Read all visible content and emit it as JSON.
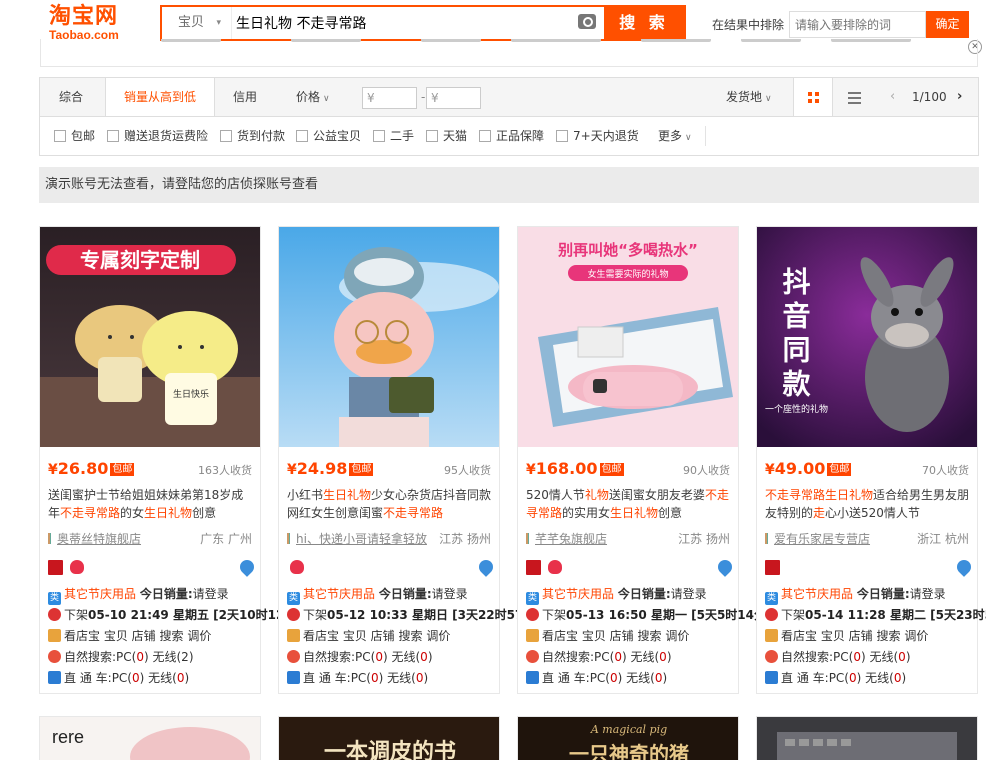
{
  "header": {
    "logo_cn": "淘宝网",
    "logo_en": "Taobao.com",
    "search_category": "宝贝",
    "search_value": "生日礼物 不走寻常路",
    "search_button": "搜 索",
    "exclude_label": "在结果中排除",
    "exclude_placeholder": "请输入要排除的词",
    "exclude_button": "确定",
    "close": "✕"
  },
  "sortbar": {
    "items": [
      "综合",
      "销量从高到低",
      "信用",
      "价格"
    ],
    "price_min": "¥",
    "price_max": "¥",
    "ship_from": "发货地",
    "page": "1/100",
    "prev": "‹",
    "next": "›"
  },
  "filters": [
    "包邮",
    "赠送退货运费险",
    "货到付款",
    "公益宝贝",
    "二手",
    "天猫",
    "正品保障",
    "7+天内退货"
  ],
  "filters_more": "更多",
  "notice": "演示账号无法查看，请登陆您的店侦探账号查看",
  "common": {
    "price_tag": "包邮",
    "yen": "¥",
    "cat_prefix": "其它节庆用品",
    "sales_label": "今日销量:",
    "sales_value": "请登录",
    "shelf_prefix": "下架",
    "tools": [
      "看店宝 宝贝",
      "店铺",
      "搜索",
      "调价"
    ],
    "natural_search": "自然搜索:",
    "pc": "PC(",
    "zero": "0",
    "close_paren": ")",
    "wireless": " 无线(",
    "through_train": "直 通 车:",
    "icon_colors": {
      "cat": "#2d8be0",
      "clock": "#d33",
      "tool": "#e8a33c",
      "search": "#e8503c",
      "car": "#2b7cd3"
    }
  },
  "cards": [
    {
      "price": "26.80",
      "sold": "163人收货",
      "title_parts": [
        "送闺蜜护士节给姐姐妹妹弟第18岁成年",
        "不走寻常路",
        "的女",
        "生日礼物",
        "创意"
      ],
      "shop": "奥蒂丝特旗舰店",
      "location": "广东 广州",
      "shelf_time": "05-10 21:49 星期五 [2天10时12分]",
      "wireless_count": "2",
      "wireless_red": false
    },
    {
      "price": "24.98",
      "sold": "95人收货",
      "title_parts": [
        "小红书",
        "生日礼物",
        "少女心杂货店抖音同款网红女生创意闺蜜",
        "不走寻常路",
        ""
      ],
      "shop": "hi、快递小哥请轻拿轻放",
      "location": "江苏 扬州",
      "shelf_time": "05-12 10:33 星期日 [3天22时57分]",
      "wireless_count": "0",
      "wireless_red": true
    },
    {
      "price": "168.00",
      "sold": "90人收货",
      "title_parts": [
        "520情人节",
        "礼物",
        "送闺蜜女朋友老婆",
        "不走寻常路",
        "的实用女",
        "生日礼物",
        "创意"
      ],
      "shop": "芊芊兔旗舰店",
      "location": "江苏 扬州",
      "shelf_time": "05-13 16:50 星期一 [5天5时14分]",
      "wireless_count": "0",
      "wireless_red": true
    },
    {
      "price": "49.00",
      "sold": "70人收货",
      "title_parts": [
        "",
        "不走寻常路生日礼物",
        "适合给男生男友朋友特别的",
        "走",
        "心小送520情人节"
      ],
      "shop": "爱有乐家居专营店",
      "location": "浙江 杭州",
      "shelf_time": "05-14 11:28 星期二 [5天23时52分]",
      "wireless_count": "0",
      "wireless_red": true
    }
  ],
  "images": {
    "img1_banner": "专属刻字定制",
    "img1_lamp": "生日快乐",
    "img3_banner": "别再叫她“多喝热水”",
    "img3_sub": "女生需要实际的礼物",
    "img4_big": "抖音同款",
    "img4_small": "一个座性的礼物",
    "row2_1": "rere",
    "row2_2": "一本调皮的书",
    "row2_3_script": "A magical pig",
    "row2_3": "一只神奇的猪"
  }
}
